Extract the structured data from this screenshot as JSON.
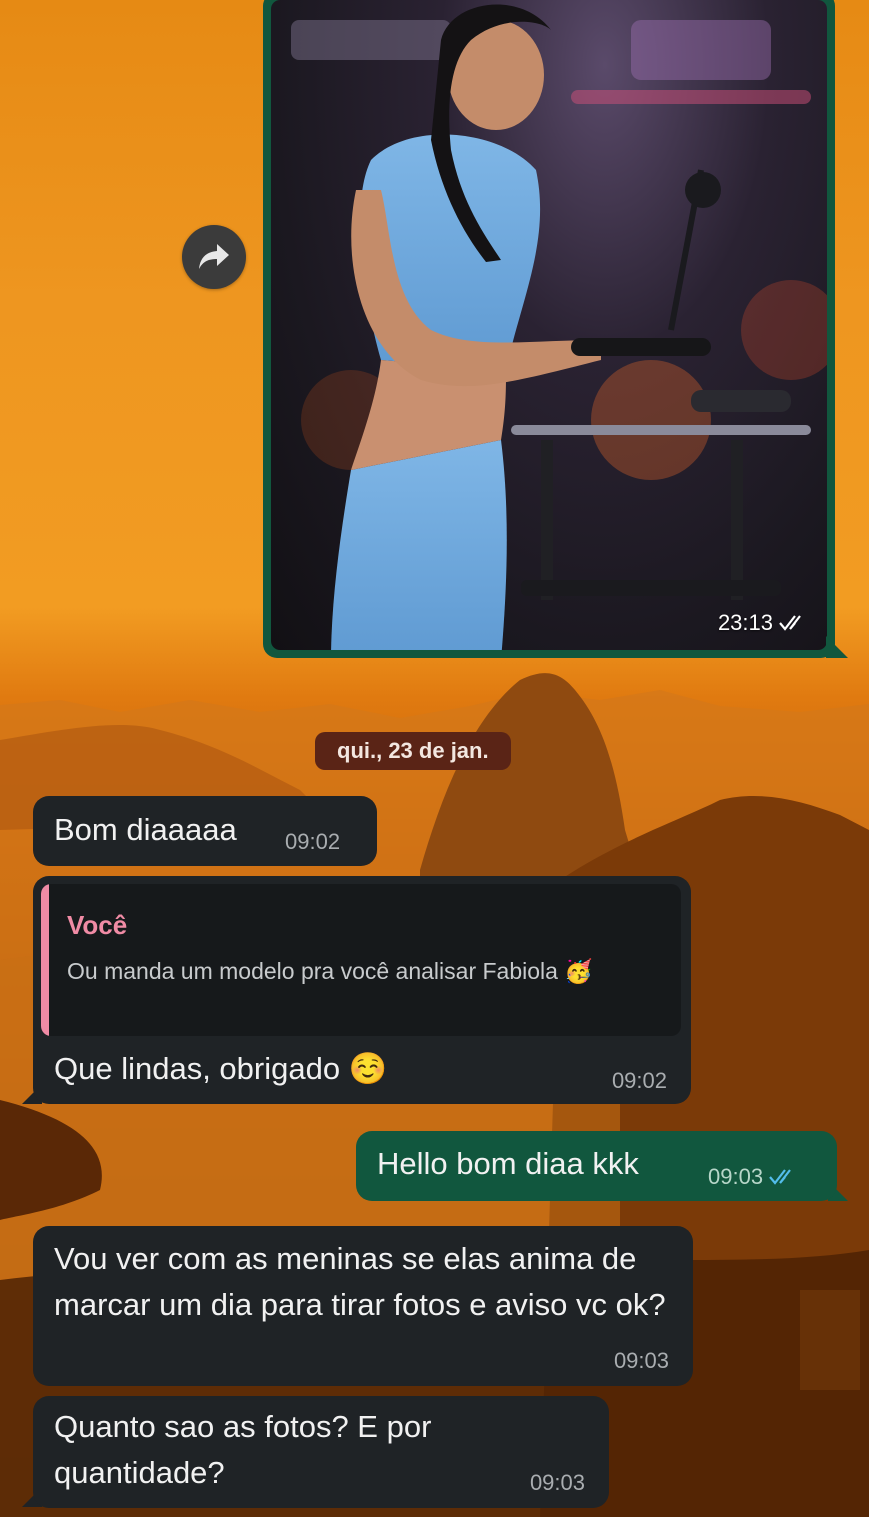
{
  "forwarded_photo": {
    "time": "23:13",
    "status": "read"
  },
  "date_separator": "qui., 23 de jan.",
  "messages": [
    {
      "direction": "in",
      "text": "Bom diaaaaa",
      "time": "09:02"
    },
    {
      "direction": "in",
      "quote": {
        "author": "Você",
        "text": "Ou manda um modelo pra você analisar Fabiola 🥳"
      },
      "text": "Que lindas, obrigado ☺️",
      "time": "09:02"
    },
    {
      "direction": "out",
      "text": "Hello bom diaa kkk",
      "time": "09:03",
      "status": "read"
    },
    {
      "direction": "in",
      "text": "Vou ver com as meninas se elas anima de marcar um dia para tirar fotos e aviso vc ok?",
      "time": "09:03"
    },
    {
      "direction": "in",
      "text": "Quanto sao as fotos? E por quantidade?",
      "time": "09:03"
    }
  ],
  "colors": {
    "incoming_bubble": "#1f2326",
    "outgoing_bubble": "#11573e",
    "quote_accent": "#f08ba5",
    "read_receipt": "#53bdeb"
  },
  "icons": [
    "forward-icon",
    "double-check-icon"
  ]
}
